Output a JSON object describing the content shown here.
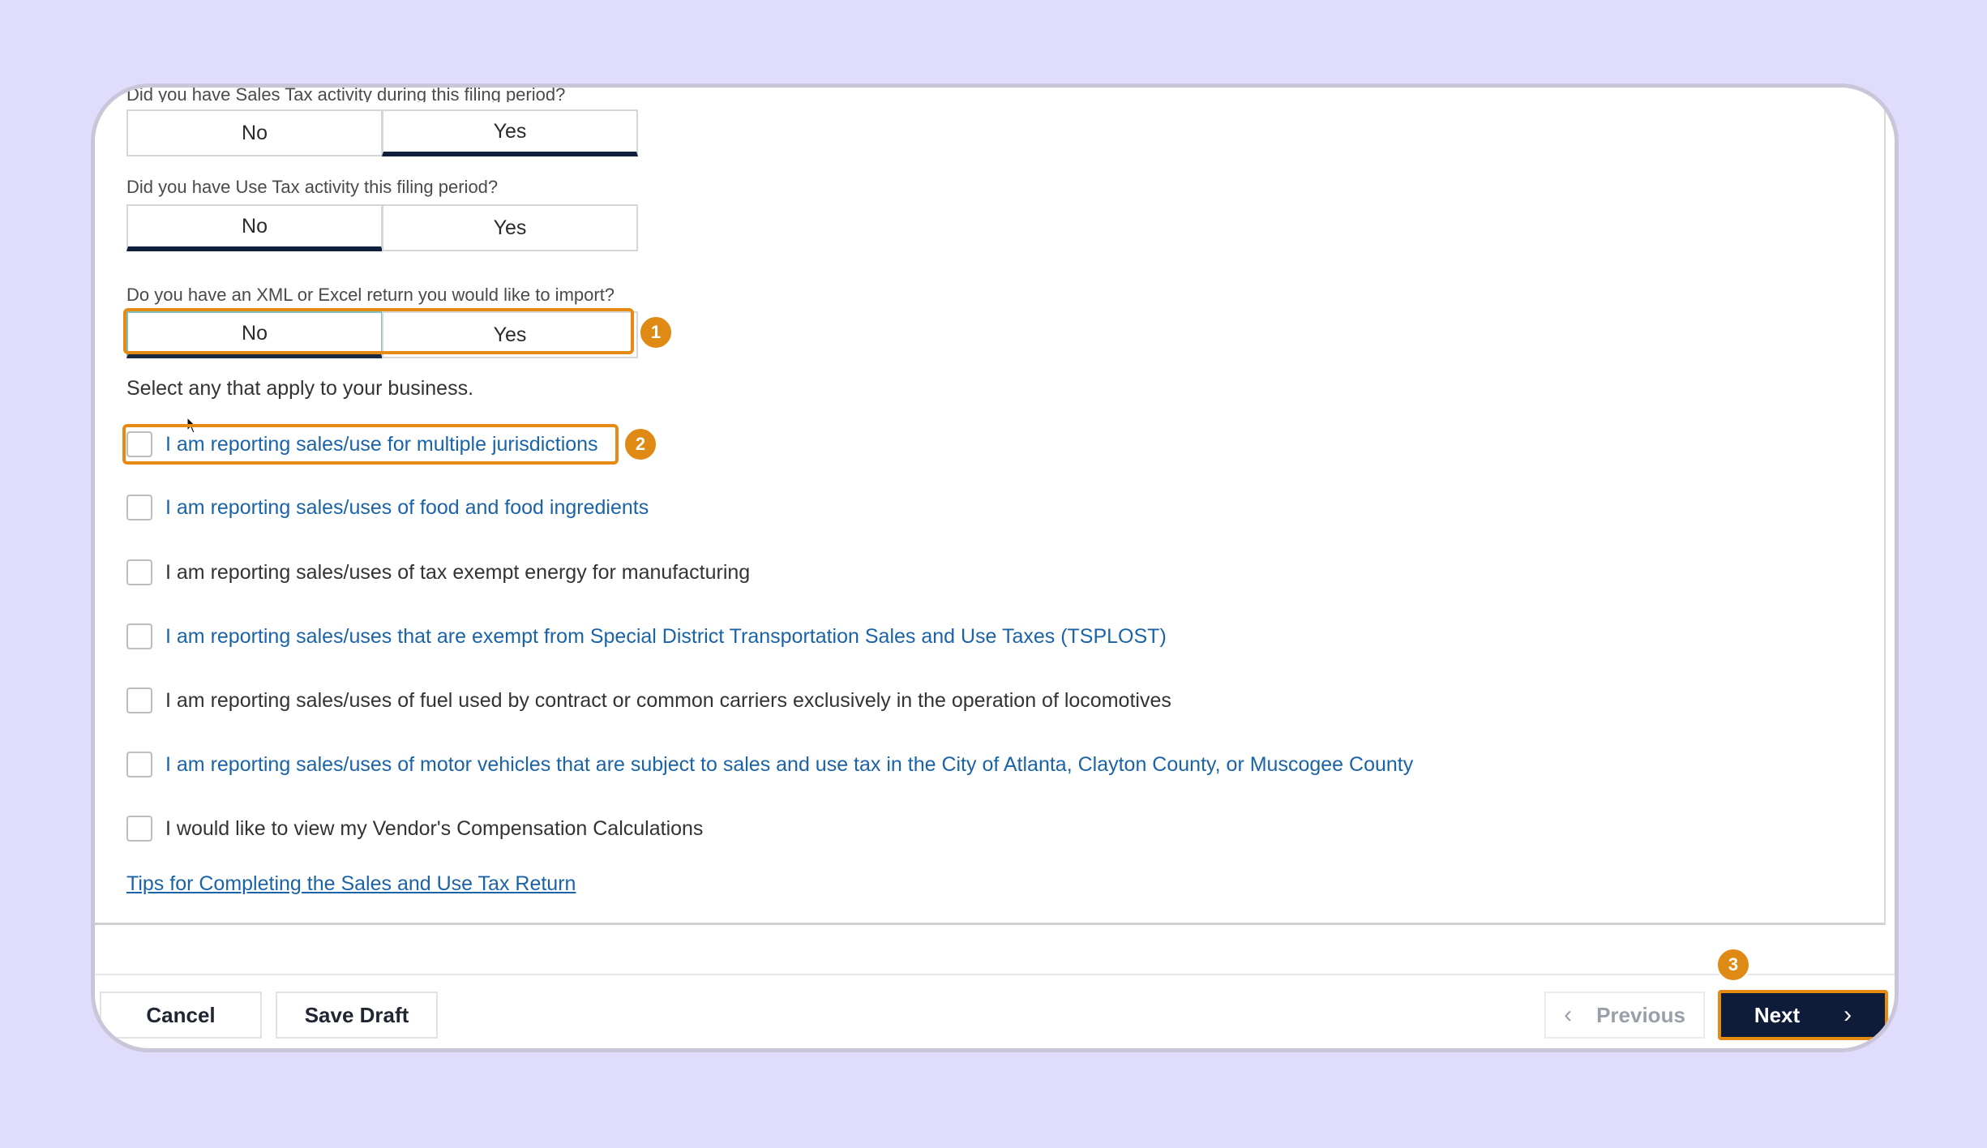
{
  "questions": [
    {
      "label": "Did you have Sales Tax activity during this filing period?",
      "no": "No",
      "yes": "Yes",
      "selected": "Yes"
    },
    {
      "label": "Did you have Use Tax activity this filing period?",
      "no": "No",
      "yes": "Yes",
      "selected": "No"
    },
    {
      "label": "Do you have an XML or Excel return you would like to import?",
      "no": "No",
      "yes": "Yes",
      "selected": "No"
    }
  ],
  "section_title": "Select any that apply to your business.",
  "options": [
    {
      "label": "I am reporting sales/use for multiple jurisdictions",
      "checked": false
    },
    {
      "label": "I am reporting sales/uses of food and food ingredients",
      "checked": false
    },
    {
      "label": "I am reporting sales/uses of tax exempt energy for manufacturing",
      "checked": false
    },
    {
      "label": "I am reporting sales/uses that are exempt from Special District Transportation Sales and Use Taxes (TSPLOST)",
      "checked": false
    },
    {
      "label": "I am reporting sales/uses of fuel used by contract or common carriers exclusively in the operation of locomotives",
      "checked": false
    },
    {
      "label": "I am reporting sales/uses of motor vehicles that are subject to sales and use tax in the City of Atlanta, Clayton County, or Muscogee County",
      "checked": false
    },
    {
      "label": "I would like to view my Vendor's Compensation Calculations",
      "checked": false
    }
  ],
  "tips_link": "Tips for Completing the Sales and Use Tax Return",
  "footer": {
    "cancel": "Cancel",
    "save_draft": "Save Draft",
    "previous": "Previous",
    "next": "Next"
  },
  "markers": [
    "1",
    "2",
    "3"
  ],
  "colors": {
    "accent": "#e58a12",
    "primary": "#0e1c3a",
    "link": "#1b63a7",
    "background": "#dfddfb"
  }
}
